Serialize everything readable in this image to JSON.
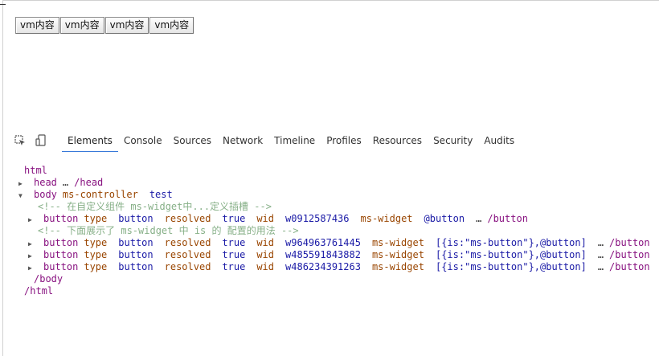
{
  "page": {
    "vm_buttons": [
      "vm内容",
      "vm内容",
      "vm内容",
      "vm内容"
    ]
  },
  "devtools": {
    "tabs": [
      "Elements",
      "Console",
      "Sources",
      "Network",
      "Timeline",
      "Profiles",
      "Resources",
      "Security",
      "Audits"
    ],
    "active_tab": "Elements",
    "icons": [
      "inspect-icon",
      "device-mode-icon"
    ],
    "accent_color": "#3879d9",
    "tree": {
      "html_open": "html",
      "head": {
        "open": "head",
        "ellipsis": "…",
        "close": "/head"
      },
      "body": {
        "tag": "body",
        "attr": "ms-controller",
        "value": "test"
      },
      "comment1": "<!-- 在自定义组件 ms-widget中...定义插槽 -->",
      "row1": {
        "tag": "button",
        "type_attr": "type",
        "type_val": "button",
        "resolved_attr": "resolved",
        "resolved_val": "true",
        "wid_attr": "wid",
        "wid_val": "w0912587436",
        "widget_attr": "ms-widget",
        "widget_val": "@button",
        "ellipsis": "…",
        "close": "/button"
      },
      "comment2": "<!-- 下面展示了 ms-widget 中 is 的 配置的用法 -->",
      "rows": [
        {
          "tag": "button",
          "type_attr": "type",
          "type_val": "button",
          "resolved_attr": "resolved",
          "resolved_val": "true",
          "wid_attr": "wid",
          "wid_val": "w964963761445",
          "widget_attr": "ms-widget",
          "widget_val": "[{is:\"ms-button\"},@button]",
          "ellipsis": "…",
          "close": "/button"
        },
        {
          "tag": "button",
          "type_attr": "type",
          "type_val": "button",
          "resolved_attr": "resolved",
          "resolved_val": "true",
          "wid_attr": "wid",
          "wid_val": "w485591843882",
          "widget_attr": "ms-widget",
          "widget_val": "[{is:\"ms-button\"},@button]",
          "ellipsis": "…",
          "close": "/button"
        },
        {
          "tag": "button",
          "type_attr": "type",
          "type_val": "button",
          "resolved_attr": "resolved",
          "resolved_val": "true",
          "wid_attr": "wid",
          "wid_val": "w486234391263",
          "widget_attr": "ms-widget",
          "widget_val": "[{is:\"ms-button\"},@button]",
          "ellipsis": "…",
          "close": "/button"
        }
      ],
      "body_close": "/body",
      "html_close": "/html"
    }
  }
}
